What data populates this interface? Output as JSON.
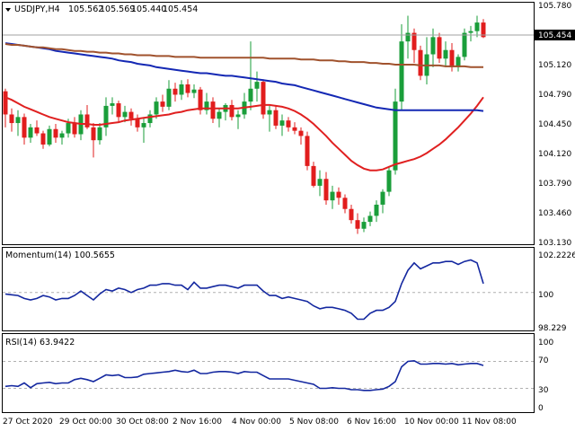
{
  "header": {
    "symbol_timeframe": "USDJPY,H4",
    "open": "105.562",
    "high": "105.569",
    "low": "105.440",
    "close": "105.454"
  },
  "price_axis": {
    "ticks": [
      "105.780",
      "105.454",
      "105.120",
      "104.790",
      "104.450",
      "104.120",
      "103.790",
      "103.460",
      "103.130"
    ],
    "current_price": "105.454"
  },
  "momentum": {
    "label": "Momentum(14) 100.5655",
    "ticks": [
      "102.2226",
      "100",
      "98.229"
    ]
  },
  "rsi": {
    "label": "RSI(14) 63.9422",
    "ticks": [
      "100",
      "70",
      "30",
      "0"
    ]
  },
  "time_axis": {
    "labels": [
      "27 Oct 2020",
      "29 Oct 00:00",
      "30 Oct 08:00",
      "2 Nov 16:00",
      "4 Nov 00:00",
      "5 Nov 08:00",
      "6 Nov 16:00",
      "10 Nov 00:00",
      "11 Nov 08:00"
    ]
  },
  "colors": {
    "bull": "#1a9e3a",
    "bear": "#e11d1d",
    "ma_fast": "#e02020",
    "ma_mid": "#1428b4",
    "ma_slow": "#a0522d",
    "indicator": "#1428a0",
    "grid": "#b0b0b0"
  },
  "chart_data": [
    {
      "type": "candlestick",
      "title": "USDJPY,H4",
      "ylim": [
        103.05,
        105.83
      ],
      "candles": [
        [
          104.82,
          104.85,
          104.4,
          104.55
        ],
        [
          104.55,
          104.62,
          104.35,
          104.45
        ],
        [
          104.45,
          104.6,
          104.3,
          104.52
        ],
        [
          104.52,
          104.56,
          104.2,
          104.28
        ],
        [
          104.28,
          104.44,
          104.22,
          104.4
        ],
        [
          104.4,
          104.48,
          104.3,
          104.33
        ],
        [
          104.33,
          104.36,
          104.15,
          104.2
        ],
        [
          104.2,
          104.42,
          104.18,
          104.38
        ],
        [
          104.38,
          104.44,
          104.22,
          104.28
        ],
        [
          104.28,
          104.36,
          104.2,
          104.33
        ],
        [
          104.33,
          104.5,
          104.28,
          104.45
        ],
        [
          104.45,
          104.52,
          104.28,
          104.32
        ],
        [
          104.32,
          104.6,
          104.25,
          104.55
        ],
        [
          104.55,
          104.66,
          104.38,
          104.4
        ],
        [
          104.4,
          104.45,
          104.05,
          104.25
        ],
        [
          104.25,
          104.45,
          104.2,
          104.4
        ],
        [
          104.4,
          104.75,
          104.3,
          104.65
        ],
        [
          104.65,
          104.75,
          104.55,
          104.68
        ],
        [
          104.68,
          104.71,
          104.45,
          104.52
        ],
        [
          104.52,
          104.65,
          104.46,
          104.58
        ],
        [
          104.58,
          104.62,
          104.42,
          104.5
        ],
        [
          104.5,
          104.55,
          104.35,
          104.4
        ],
        [
          104.4,
          104.52,
          104.22,
          104.45
        ],
        [
          104.45,
          104.6,
          104.4,
          104.55
        ],
        [
          104.55,
          104.75,
          104.5,
          104.7
        ],
        [
          104.7,
          104.78,
          104.58,
          104.64
        ],
        [
          104.64,
          104.95,
          104.6,
          104.85
        ],
        [
          104.85,
          104.92,
          104.7,
          104.78
        ],
        [
          104.78,
          104.95,
          104.72,
          104.9
        ],
        [
          104.9,
          104.96,
          104.75,
          104.8
        ],
        [
          104.8,
          104.9,
          104.74,
          104.84
        ],
        [
          104.84,
          104.87,
          104.55,
          104.6
        ],
        [
          104.6,
          104.8,
          104.55,
          104.7
        ],
        [
          104.7,
          104.75,
          104.45,
          104.5
        ],
        [
          104.5,
          104.62,
          104.4,
          104.58
        ],
        [
          104.58,
          104.68,
          104.48,
          104.66
        ],
        [
          104.66,
          104.72,
          104.48,
          104.52
        ],
        [
          104.52,
          104.6,
          104.38,
          104.55
        ],
        [
          104.55,
          104.8,
          104.5,
          104.7
        ],
        [
          104.7,
          105.4,
          104.6,
          104.85
        ],
        [
          104.85,
          105.05,
          104.7,
          104.93
        ],
        [
          104.93,
          104.96,
          104.5,
          104.55
        ],
        [
          104.55,
          104.65,
          104.35,
          104.6
        ],
        [
          104.6,
          104.66,
          104.38,
          104.42
        ],
        [
          104.42,
          104.55,
          104.3,
          104.48
        ],
        [
          104.48,
          104.52,
          104.35,
          104.4
        ],
        [
          104.4,
          104.46,
          104.32,
          104.36
        ],
        [
          104.36,
          104.4,
          104.2,
          104.3
        ],
        [
          104.3,
          104.35,
          103.9,
          103.95
        ],
        [
          103.95,
          104.0,
          103.7,
          103.72
        ],
        [
          103.72,
          103.9,
          103.6,
          103.8
        ],
        [
          103.8,
          103.88,
          103.5,
          103.55
        ],
        [
          103.55,
          103.72,
          103.45,
          103.65
        ],
        [
          103.65,
          103.7,
          103.5,
          103.58
        ],
        [
          103.58,
          103.62,
          103.4,
          103.45
        ],
        [
          103.45,
          103.5,
          103.28,
          103.32
        ],
        [
          103.32,
          103.4,
          103.16,
          103.22
        ],
        [
          103.22,
          103.35,
          103.18,
          103.3
        ],
        [
          103.3,
          103.42,
          103.25,
          103.37
        ],
        [
          103.37,
          103.55,
          103.3,
          103.5
        ],
        [
          103.5,
          103.68,
          103.4,
          103.65
        ],
        [
          103.65,
          103.95,
          103.6,
          103.9
        ],
        [
          103.9,
          104.85,
          103.85,
          104.7
        ],
        [
          104.7,
          105.6,
          104.6,
          105.4
        ],
        [
          105.4,
          105.7,
          105.2,
          105.5
        ],
        [
          105.5,
          105.55,
          105.15,
          105.3
        ],
        [
          105.3,
          105.35,
          104.95,
          105.0
        ],
        [
          105.0,
          105.45,
          104.9,
          105.25
        ],
        [
          105.25,
          105.55,
          105.1,
          105.45
        ],
        [
          105.45,
          105.5,
          105.15,
          105.2
        ],
        [
          105.2,
          105.4,
          105.1,
          105.3
        ],
        [
          105.3,
          105.38,
          105.05,
          105.1
        ],
        [
          105.1,
          105.25,
          105.05,
          105.22
        ],
        [
          105.22,
          105.55,
          105.18,
          105.5
        ],
        [
          105.5,
          105.58,
          105.4,
          105.52
        ],
        [
          105.52,
          105.7,
          105.45,
          105.62
        ],
        [
          105.62,
          105.66,
          105.44,
          105.45
        ]
      ],
      "series": [
        {
          "values": [
            104.75,
            104.72,
            104.68,
            104.64,
            104.61,
            104.58,
            104.55,
            104.52,
            104.5,
            104.48,
            104.46,
            104.45,
            104.44,
            104.44,
            104.43,
            104.43,
            104.44,
            104.45,
            104.46,
            104.48,
            104.49,
            104.5,
            104.51,
            104.52,
            104.53,
            104.54,
            104.55,
            104.57,
            104.58,
            104.6,
            104.61,
            104.62,
            104.62,
            104.62,
            104.62,
            104.62,
            104.62,
            104.62,
            104.63,
            104.64,
            104.65,
            104.66,
            104.66,
            104.65,
            104.64,
            104.62,
            104.59,
            104.55,
            104.5,
            104.44,
            104.37,
            104.3,
            104.22,
            104.15,
            104.08,
            104.01,
            103.96,
            103.92,
            103.9,
            103.9,
            103.91,
            103.94,
            103.97,
            103.99,
            104.01,
            104.03,
            104.06,
            104.1,
            104.15,
            104.2,
            104.26,
            104.33,
            104.4,
            104.48,
            104.56,
            104.65,
            104.75
          ]
        },
        {
          "values": [
            105.38,
            105.37,
            105.36,
            105.35,
            105.34,
            105.33,
            105.32,
            105.31,
            105.29,
            105.28,
            105.27,
            105.26,
            105.25,
            105.24,
            105.23,
            105.22,
            105.21,
            105.2,
            105.18,
            105.17,
            105.16,
            105.14,
            105.13,
            105.12,
            105.1,
            105.09,
            105.08,
            105.07,
            105.06,
            105.05,
            105.04,
            105.03,
            105.03,
            105.02,
            105.01,
            105.0,
            105.0,
            104.99,
            104.98,
            104.97,
            104.96,
            104.95,
            104.94,
            104.93,
            104.91,
            104.9,
            104.89,
            104.87,
            104.85,
            104.83,
            104.81,
            104.79,
            104.77,
            104.75,
            104.73,
            104.71,
            104.69,
            104.67,
            104.65,
            104.63,
            104.62,
            104.61,
            104.6,
            104.6,
            104.6,
            104.6,
            104.6,
            104.6,
            104.6,
            104.6,
            104.6,
            104.6,
            104.6,
            104.6,
            104.6,
            104.6,
            104.59
          ]
        },
        {
          "values": [
            105.37,
            105.36,
            105.36,
            105.35,
            105.34,
            105.33,
            105.33,
            105.32,
            105.31,
            105.31,
            105.3,
            105.29,
            105.29,
            105.28,
            105.28,
            105.27,
            105.27,
            105.26,
            105.26,
            105.25,
            105.25,
            105.24,
            105.24,
            105.24,
            105.23,
            105.23,
            105.23,
            105.22,
            105.22,
            105.22,
            105.22,
            105.21,
            105.21,
            105.21,
            105.21,
            105.21,
            105.21,
            105.21,
            105.21,
            105.21,
            105.21,
            105.21,
            105.2,
            105.2,
            105.2,
            105.2,
            105.2,
            105.19,
            105.19,
            105.19,
            105.18,
            105.18,
            105.18,
            105.17,
            105.17,
            105.16,
            105.16,
            105.16,
            105.15,
            105.15,
            105.14,
            105.14,
            105.13,
            105.13,
            105.13,
            105.13,
            105.12,
            105.12,
            105.12,
            105.12,
            105.11,
            105.11,
            105.11,
            105.11,
            105.1,
            105.1,
            105.1
          ]
        }
      ]
    },
    {
      "type": "line",
      "title": "Momentum(14) 100.5655",
      "ylim": [
        97.5,
        102.9
      ],
      "series": [
        {
          "values": [
            99.9,
            99.85,
            99.8,
            99.6,
            99.5,
            99.6,
            99.8,
            99.7,
            99.5,
            99.6,
            99.6,
            99.8,
            100.1,
            99.8,
            99.5,
            99.9,
            100.2,
            100.1,
            100.3,
            100.2,
            100.0,
            100.2,
            100.3,
            100.5,
            100.5,
            100.6,
            100.6,
            100.5,
            100.5,
            100.2,
            100.7,
            100.3,
            100.3,
            100.4,
            100.5,
            100.5,
            100.4,
            100.3,
            100.5,
            100.5,
            100.5,
            100.1,
            99.8,
            99.8,
            99.6,
            99.7,
            99.6,
            99.5,
            99.4,
            99.1,
            98.9,
            99.0,
            99.0,
            98.9,
            98.8,
            98.6,
            98.2,
            98.2,
            98.6,
            98.8,
            98.8,
            99.0,
            99.4,
            100.6,
            101.5,
            102.0,
            101.6,
            101.8,
            102.0,
            102.0,
            102.1,
            102.1,
            101.9,
            102.1,
            102.2,
            102.0,
            100.6
          ]
        }
      ]
    },
    {
      "type": "line",
      "title": "RSI(14) 63.9422",
      "ylim": [
        0,
        100
      ],
      "levels": [
        70,
        30
      ],
      "series": [
        {
          "values": [
            33,
            34,
            33,
            38,
            31,
            37,
            38,
            39,
            37,
            38,
            38,
            43,
            45,
            43,
            40,
            45,
            50,
            49,
            50,
            46,
            46,
            47,
            51,
            52,
            53,
            54,
            55,
            57,
            55,
            54,
            57,
            52,
            52,
            54,
            55,
            55,
            54,
            52,
            55,
            54,
            54,
            49,
            44,
            44,
            44,
            44,
            42,
            40,
            38,
            36,
            30,
            30,
            31,
            30,
            30,
            28,
            28,
            27,
            27,
            28,
            29,
            33,
            40,
            62,
            70,
            71,
            66,
            66,
            67,
            67,
            66,
            67,
            65,
            66,
            67,
            67,
            64
          ]
        }
      ]
    }
  ]
}
